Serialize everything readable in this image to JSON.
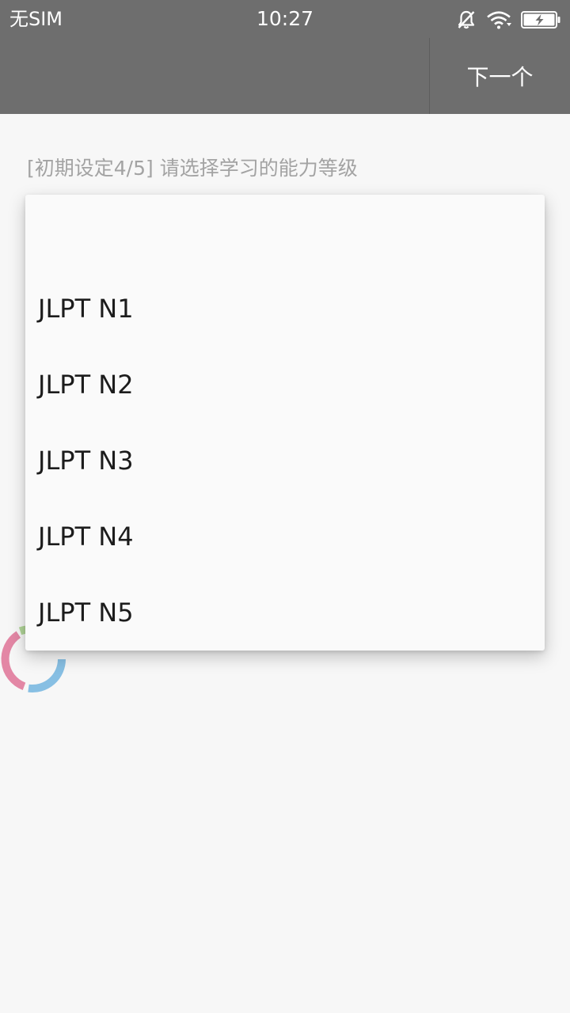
{
  "status_bar": {
    "carrier": "无SIM",
    "time": "10:27",
    "icons": [
      "mute-bell-icon",
      "wifi-icon",
      "battery-charging-icon"
    ]
  },
  "toolbar": {
    "next_label": "下一个"
  },
  "prompt": {
    "text": "[初期设定4/5] 请选择学习的能力等级"
  },
  "level_dropdown": {
    "options": [
      {
        "label": ""
      },
      {
        "label": "JLPT N1"
      },
      {
        "label": "JLPT N2"
      },
      {
        "label": "JLPT N3"
      },
      {
        "label": "JLPT N4"
      },
      {
        "label": "JLPT N5"
      }
    ]
  },
  "colors": {
    "bar": "#6e6e6e",
    "background": "#f7f7f7",
    "dropdown": "#fafafa",
    "prompt_text": "#a3a3a3",
    "spinner": [
      "#e07a9b",
      "#a8d08d",
      "#f5d77a",
      "#7ab8e0"
    ]
  }
}
